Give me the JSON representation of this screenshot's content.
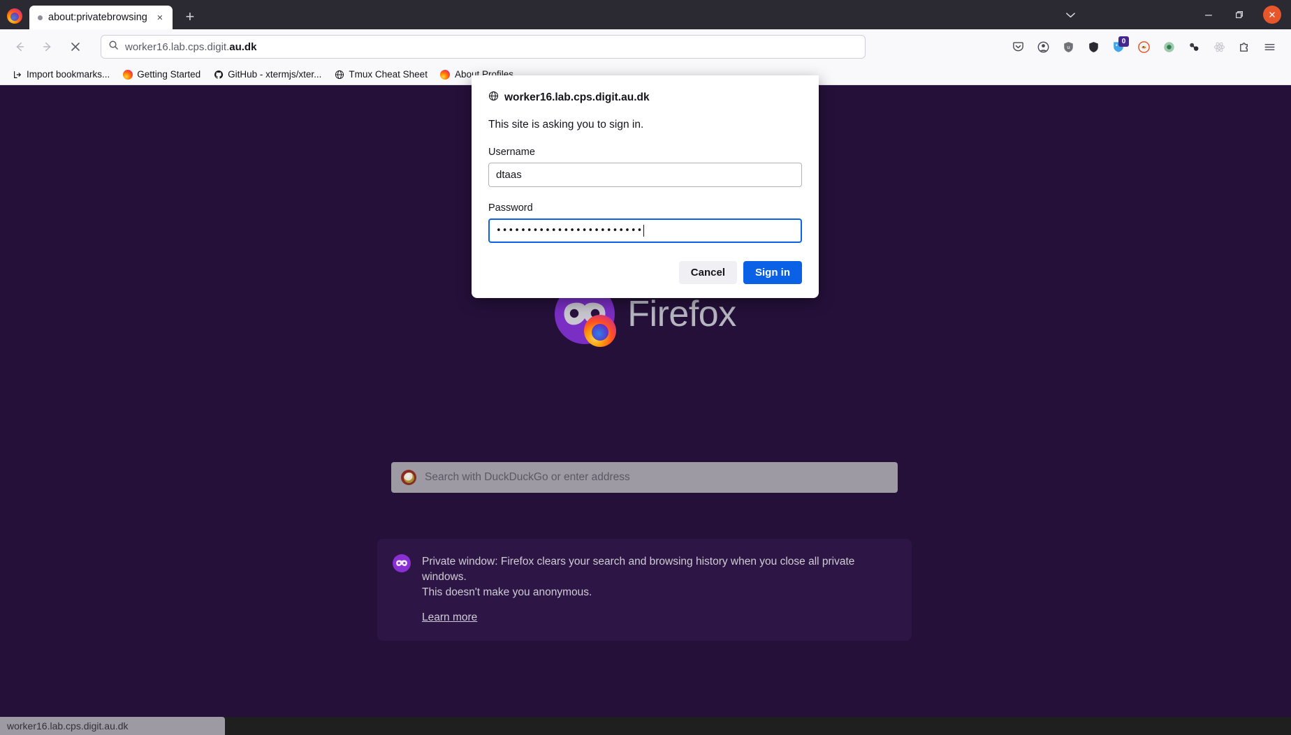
{
  "window": {
    "controls": {
      "list_tabs": "list-all-tabs",
      "minimize": "minimize",
      "maximize": "maximize",
      "close": "close"
    }
  },
  "tabs": [
    {
      "title": "about:privatebrowsing",
      "loading_dot": "•",
      "close": "×"
    }
  ],
  "newtab_label": "+",
  "nav": {
    "back": "←",
    "forward": "→",
    "stop": "✕",
    "url_prefix": "worker16.lab.cps.digit.",
    "url_suffix": "au.dk",
    "search_icon": "search-icon"
  },
  "toolbar_icons": [
    {
      "name": "pocket-icon",
      "glyph": "pocket"
    },
    {
      "name": "account-icon",
      "glyph": "account"
    },
    {
      "name": "ublock-origin-icon",
      "glyph": "ublock"
    },
    {
      "name": "extension-dark-icon",
      "glyph": "dark"
    },
    {
      "name": "bitwarden-icon",
      "glyph": "bitwarden",
      "badge": "0"
    },
    {
      "name": "privacy-badger-icon",
      "glyph": "badger"
    },
    {
      "name": "decentraleyes-icon",
      "glyph": "decentraleyes"
    },
    {
      "name": "molecule-extension-icon",
      "glyph": "molecule"
    },
    {
      "name": "react-devtools-icon",
      "glyph": "react"
    },
    {
      "name": "extensions-puzzle-icon",
      "glyph": "puzzle"
    },
    {
      "name": "app-menu-icon",
      "glyph": "hamburger"
    }
  ],
  "bookmarks": [
    {
      "label": "Import bookmarks...",
      "icon": "import-icon"
    },
    {
      "label": "Getting Started",
      "icon": "firefox-icon"
    },
    {
      "label": "GitHub - xtermjs/xter...",
      "icon": "github-icon"
    },
    {
      "label": "Tmux Cheat Sheet",
      "icon": "globe-icon"
    },
    {
      "label": "About Profiles",
      "icon": "firefox-icon"
    }
  ],
  "private_page": {
    "wordmark": "Firefox",
    "search_placeholder": "Search with DuckDuckGo or enter address",
    "info_line_1": "Private window: Firefox clears your search and browsing history when you close all private windows.",
    "info_line_2": "This doesn't make you anonymous.",
    "learn_more": "Learn more"
  },
  "auth_dialog": {
    "host": "worker16.lab.cps.digit.au.dk",
    "message": "This site is asking you to sign in.",
    "username_label": "Username",
    "username_value": "dtaas",
    "password_label": "Password",
    "password_masked": "••••••••••••••••••••••••",
    "cancel_label": "Cancel",
    "signin_label": "Sign in"
  },
  "statusbar": {
    "url": "worker16.lab.cps.digit.au.dk"
  },
  "colors": {
    "accent_blue": "#0b61e6",
    "private_bg": "#25103a",
    "chrome_bg": "#f9f9fb",
    "tabbar_bg": "#2b2a33",
    "close_btn": "#e8562b",
    "badge_bg": "#45278d"
  }
}
